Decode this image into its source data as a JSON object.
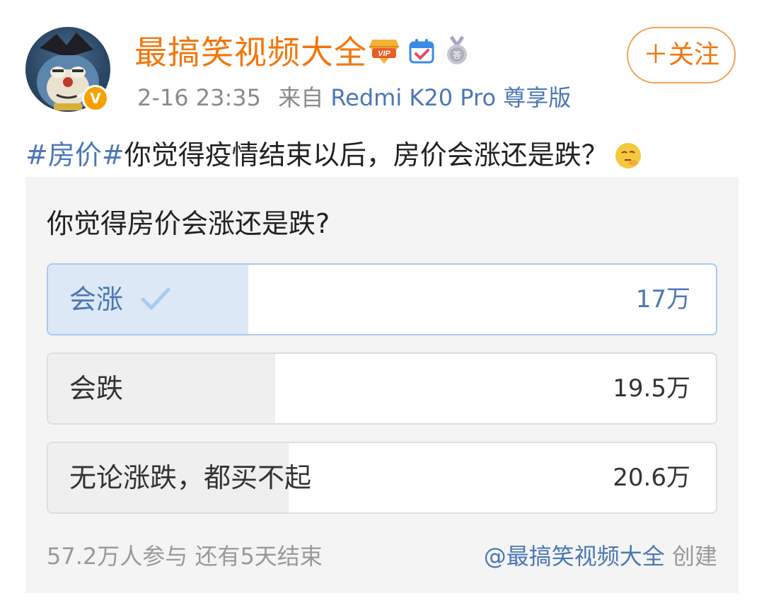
{
  "header": {
    "username": "最搞笑视频大全",
    "verified_badge": "V",
    "badges": [
      "vip-diamond-icon",
      "checkin-calendar-icon",
      "medal-icon"
    ],
    "time": "2-16 23:35",
    "source_label": "来自",
    "device": "Redmi K20 Pro 尊享版",
    "follow_label": "＋关注"
  },
  "post": {
    "hashtag": "#房价#",
    "text": "你觉得疫情结束以后，房价会涨还是跌？",
    "emoji": "thinking-face-icon"
  },
  "poll": {
    "question": "你觉得房价会涨还是跌?",
    "options": [
      {
        "label": "会涨",
        "count": "17万",
        "share": 0.3,
        "selected": true
      },
      {
        "label": "会跌",
        "count": "19.5万",
        "share": 0.34,
        "selected": false
      },
      {
        "label": "无论涨跌，都买不起",
        "count": "20.6万",
        "share": 0.36,
        "selected": false
      }
    ],
    "participants": "57.2万人参与",
    "remaining": "还有5天结束",
    "creator": "@最搞笑视频大全",
    "created_label": "创建"
  },
  "colors": {
    "username": "#f2770d",
    "link": "#4b78b4",
    "selected_fill": "#dce8f6",
    "option_fill": "#efefef"
  }
}
